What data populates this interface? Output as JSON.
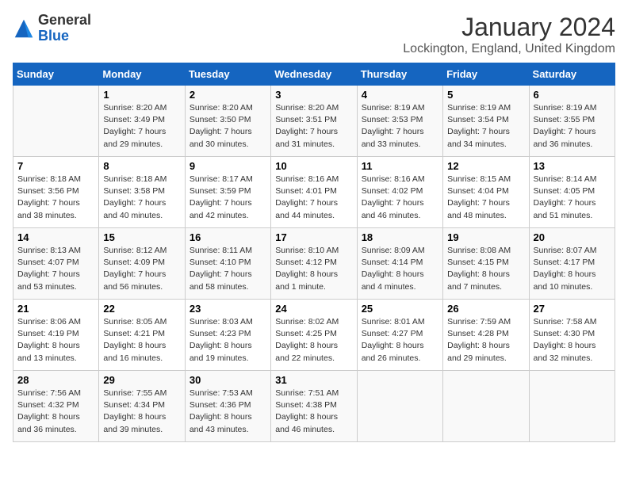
{
  "header": {
    "logo_general": "General",
    "logo_blue": "Blue",
    "month_title": "January 2024",
    "location": "Lockington, England, United Kingdom"
  },
  "days_of_week": [
    "Sunday",
    "Monday",
    "Tuesday",
    "Wednesday",
    "Thursday",
    "Friday",
    "Saturday"
  ],
  "weeks": [
    [
      {
        "day": "",
        "info": ""
      },
      {
        "day": "1",
        "info": "Sunrise: 8:20 AM\nSunset: 3:49 PM\nDaylight: 7 hours\nand 29 minutes."
      },
      {
        "day": "2",
        "info": "Sunrise: 8:20 AM\nSunset: 3:50 PM\nDaylight: 7 hours\nand 30 minutes."
      },
      {
        "day": "3",
        "info": "Sunrise: 8:20 AM\nSunset: 3:51 PM\nDaylight: 7 hours\nand 31 minutes."
      },
      {
        "day": "4",
        "info": "Sunrise: 8:19 AM\nSunset: 3:53 PM\nDaylight: 7 hours\nand 33 minutes."
      },
      {
        "day": "5",
        "info": "Sunrise: 8:19 AM\nSunset: 3:54 PM\nDaylight: 7 hours\nand 34 minutes."
      },
      {
        "day": "6",
        "info": "Sunrise: 8:19 AM\nSunset: 3:55 PM\nDaylight: 7 hours\nand 36 minutes."
      }
    ],
    [
      {
        "day": "7",
        "info": "Sunrise: 8:18 AM\nSunset: 3:56 PM\nDaylight: 7 hours\nand 38 minutes."
      },
      {
        "day": "8",
        "info": "Sunrise: 8:18 AM\nSunset: 3:58 PM\nDaylight: 7 hours\nand 40 minutes."
      },
      {
        "day": "9",
        "info": "Sunrise: 8:17 AM\nSunset: 3:59 PM\nDaylight: 7 hours\nand 42 minutes."
      },
      {
        "day": "10",
        "info": "Sunrise: 8:16 AM\nSunset: 4:01 PM\nDaylight: 7 hours\nand 44 minutes."
      },
      {
        "day": "11",
        "info": "Sunrise: 8:16 AM\nSunset: 4:02 PM\nDaylight: 7 hours\nand 46 minutes."
      },
      {
        "day": "12",
        "info": "Sunrise: 8:15 AM\nSunset: 4:04 PM\nDaylight: 7 hours\nand 48 minutes."
      },
      {
        "day": "13",
        "info": "Sunrise: 8:14 AM\nSunset: 4:05 PM\nDaylight: 7 hours\nand 51 minutes."
      }
    ],
    [
      {
        "day": "14",
        "info": "Sunrise: 8:13 AM\nSunset: 4:07 PM\nDaylight: 7 hours\nand 53 minutes."
      },
      {
        "day": "15",
        "info": "Sunrise: 8:12 AM\nSunset: 4:09 PM\nDaylight: 7 hours\nand 56 minutes."
      },
      {
        "day": "16",
        "info": "Sunrise: 8:11 AM\nSunset: 4:10 PM\nDaylight: 7 hours\nand 58 minutes."
      },
      {
        "day": "17",
        "info": "Sunrise: 8:10 AM\nSunset: 4:12 PM\nDaylight: 8 hours\nand 1 minute."
      },
      {
        "day": "18",
        "info": "Sunrise: 8:09 AM\nSunset: 4:14 PM\nDaylight: 8 hours\nand 4 minutes."
      },
      {
        "day": "19",
        "info": "Sunrise: 8:08 AM\nSunset: 4:15 PM\nDaylight: 8 hours\nand 7 minutes."
      },
      {
        "day": "20",
        "info": "Sunrise: 8:07 AM\nSunset: 4:17 PM\nDaylight: 8 hours\nand 10 minutes."
      }
    ],
    [
      {
        "day": "21",
        "info": "Sunrise: 8:06 AM\nSunset: 4:19 PM\nDaylight: 8 hours\nand 13 minutes."
      },
      {
        "day": "22",
        "info": "Sunrise: 8:05 AM\nSunset: 4:21 PM\nDaylight: 8 hours\nand 16 minutes."
      },
      {
        "day": "23",
        "info": "Sunrise: 8:03 AM\nSunset: 4:23 PM\nDaylight: 8 hours\nand 19 minutes."
      },
      {
        "day": "24",
        "info": "Sunrise: 8:02 AM\nSunset: 4:25 PM\nDaylight: 8 hours\nand 22 minutes."
      },
      {
        "day": "25",
        "info": "Sunrise: 8:01 AM\nSunset: 4:27 PM\nDaylight: 8 hours\nand 26 minutes."
      },
      {
        "day": "26",
        "info": "Sunrise: 7:59 AM\nSunset: 4:28 PM\nDaylight: 8 hours\nand 29 minutes."
      },
      {
        "day": "27",
        "info": "Sunrise: 7:58 AM\nSunset: 4:30 PM\nDaylight: 8 hours\nand 32 minutes."
      }
    ],
    [
      {
        "day": "28",
        "info": "Sunrise: 7:56 AM\nSunset: 4:32 PM\nDaylight: 8 hours\nand 36 minutes."
      },
      {
        "day": "29",
        "info": "Sunrise: 7:55 AM\nSunset: 4:34 PM\nDaylight: 8 hours\nand 39 minutes."
      },
      {
        "day": "30",
        "info": "Sunrise: 7:53 AM\nSunset: 4:36 PM\nDaylight: 8 hours\nand 43 minutes."
      },
      {
        "day": "31",
        "info": "Sunrise: 7:51 AM\nSunset: 4:38 PM\nDaylight: 8 hours\nand 46 minutes."
      },
      {
        "day": "",
        "info": ""
      },
      {
        "day": "",
        "info": ""
      },
      {
        "day": "",
        "info": ""
      }
    ]
  ]
}
